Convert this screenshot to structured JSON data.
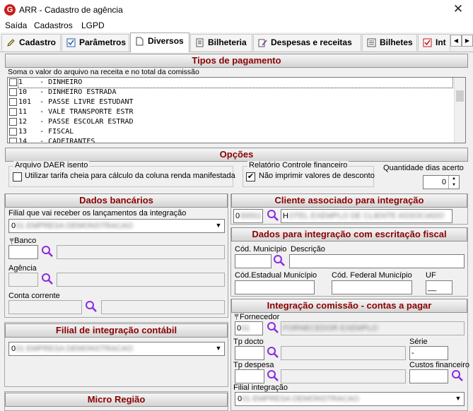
{
  "window": {
    "title": "ARR - Cadastro de agência",
    "logo_letter": "G",
    "close_glyph": "✕"
  },
  "menu": [
    "Saída",
    "Cadastros",
    "LGPD"
  ],
  "tabs": [
    {
      "label": "Cadastro",
      "icon": "pencil-icon"
    },
    {
      "label": "Parâmetros",
      "icon": "checkbox-icon"
    },
    {
      "label": "Diversos",
      "icon": "document-icon"
    },
    {
      "label": "Bilheteria",
      "icon": "ledger-icon"
    },
    {
      "label": "Despesas e receitas",
      "icon": "pen-document-icon"
    },
    {
      "label": "Bilhetes",
      "icon": "list-icon"
    },
    {
      "label": "Int",
      "icon": "checkbox-red-icon"
    }
  ],
  "tab_scroll": {
    "left": "◀",
    "right": "▶"
  },
  "tipos_pagamento": {
    "header": "Tipos de pagamento",
    "caption": "Soma o valor do arquivo na receita e no total da comissão",
    "items": [
      "1    - DINHEIRO",
      "10   - DINHEIRO ESTRADA",
      "101  - PASSE LIVRE ESTUDANT",
      "11   - VALE TRANSPORTE ESTR",
      "12   - PASSE ESCOLAR ESTRAD",
      "13   - FISCAL",
      "14   - CADEIRANTES"
    ]
  },
  "opcoes": {
    "header": "Opções",
    "daer_group": "Arquivo DAER isento",
    "daer_checkbox": "Utilizar tarifa cheia para cálculo da coluna renda  manifestada",
    "relatorio_group": "Relatório Controle financeiro",
    "relatorio_checkbox": "Não imprimir valores de desconto",
    "relatorio_checked_glyph": "✔",
    "quantidade_label": "Quantidade dias acerto",
    "quantidade_value": "0",
    "spin_up": "▲",
    "spin_down": "▼"
  },
  "dados_bancarios": {
    "header": "Dados bancários",
    "filial_label": "Filial que vai receber os lançamentos da integração",
    "filial_value": "0",
    "filial_blur": "01 EMPRESA DEMONSTRACAO",
    "banco_label": "Banco",
    "agencia_label": "Agência",
    "conta_label": "Conta corrente"
  },
  "filial_contabil": {
    "header": "Filial de integração contábil",
    "value": "0",
    "blur": "01 EMPRESA DEMONSTRACAO"
  },
  "micro_regiao": {
    "header": "Micro Região"
  },
  "cliente": {
    "header": "Cliente associado para integração",
    "code": "0",
    "code_blur": "00001",
    "name": "H",
    "name_blur": "OTEL EXEMPLO DE CLIENTE ASSOCIADO"
  },
  "escrituracao": {
    "header": "Dados para integração com escritação fiscal",
    "cod_municipio_label": "Cód. Município",
    "descricao_label": "Descrição",
    "cod_estadual_label": "Cód.Estadual Município",
    "cod_federal_label": "Cód. Federal Município",
    "uf_label": "UF",
    "uf_value": "__"
  },
  "comissao": {
    "header": "Integração comissão - contas a pagar",
    "fornecedor_label": "Fornecedor",
    "fornecedor_code": "0",
    "fornecedor_code_blur": "01",
    "fornecedor_name_blur": "FORNECEDOR EXEMPLO",
    "tp_docto_label": "Tp docto",
    "serie_label": "Série",
    "serie_value": "-",
    "tp_despesa_label": "Tp despesa",
    "custos_label": "Custos financeiro",
    "filial_label": "Filial integração",
    "filial_value": "0",
    "filial_blur": "01 EMPRESA DEMONSTRACAO"
  },
  "dropdown_arrow": "▼"
}
